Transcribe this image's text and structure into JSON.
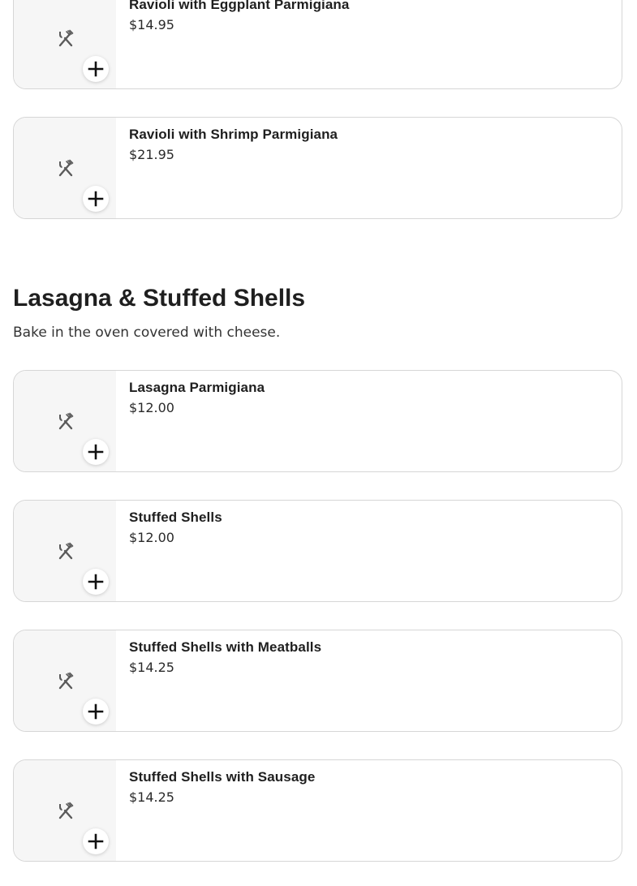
{
  "sections": [
    {
      "items": [
        {
          "name": "Ravioli with Eggplant Parmigiana",
          "price": "$14.95"
        },
        {
          "name": "Ravioli with Shrimp Parmigiana",
          "price": "$21.95"
        }
      ]
    },
    {
      "title": "Lasagna & Stuffed Shells",
      "description": "Bake in the oven covered with cheese.",
      "items": [
        {
          "name": "Lasagna Parmigiana",
          "price": "$12.00"
        },
        {
          "name": "Stuffed Shells",
          "price": "$12.00"
        },
        {
          "name": "Stuffed Shells with Meatballs",
          "price": "$14.25"
        },
        {
          "name": "Stuffed Shells with Sausage",
          "price": "$14.25"
        }
      ]
    }
  ],
  "icons": {
    "placeholder": "fork-knife-icon",
    "add": "plus-icon"
  },
  "colors": {
    "text": "#1f1f1f",
    "card_border": "#d6d6d6",
    "thumb_bg": "#f6f6f6",
    "icon": "#5a5a5a"
  }
}
